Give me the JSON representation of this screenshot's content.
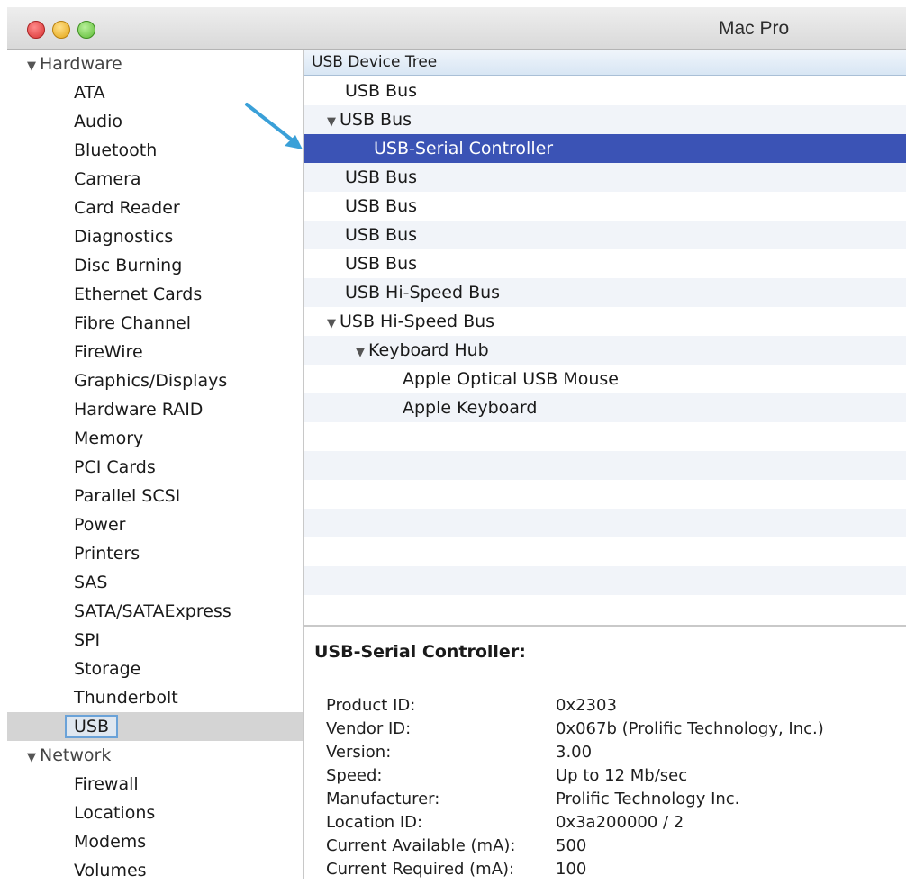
{
  "window": {
    "title": "Mac Pro"
  },
  "sidebar": {
    "hardware": {
      "label": "Hardware",
      "items": [
        "ATA",
        "Audio",
        "Bluetooth",
        "Camera",
        "Card Reader",
        "Diagnostics",
        "Disc Burning",
        "Ethernet Cards",
        "Fibre Channel",
        "FireWire",
        "Graphics/Displays",
        "Hardware RAID",
        "Memory",
        "PCI Cards",
        "Parallel SCSI",
        "Power",
        "Printers",
        "SAS",
        "SATA/SATAExpress",
        "SPI",
        "Storage",
        "Thunderbolt",
        "USB"
      ]
    },
    "network": {
      "label": "Network",
      "items": [
        "Firewall",
        "Locations",
        "Modems",
        "Volumes"
      ]
    },
    "selected": "USB"
  },
  "tree": {
    "header": "USB Device Tree",
    "rows": [
      {
        "label": "USB Bus"
      },
      {
        "label": "USB Bus",
        "expanded": true
      },
      {
        "label": "USB-Serial Controller",
        "selected": true
      },
      {
        "label": "USB Bus"
      },
      {
        "label": "USB Bus"
      },
      {
        "label": "USB Bus"
      },
      {
        "label": "USB Bus"
      },
      {
        "label": "USB Hi-Speed Bus"
      },
      {
        "label": "USB Hi-Speed Bus",
        "expanded": true
      },
      {
        "label": "Keyboard Hub",
        "expanded": true
      },
      {
        "label": "Apple Optical USB Mouse"
      },
      {
        "label": "Apple Keyboard"
      }
    ]
  },
  "detail": {
    "title": "USB-Serial Controller:",
    "fields": [
      {
        "key": "Product ID:",
        "value": "0x2303"
      },
      {
        "key": "Vendor ID:",
        "value": "0x067b  (Prolific Technology, Inc.)"
      },
      {
        "key": "Version:",
        "value": " 3.00"
      },
      {
        "key": "Speed:",
        "value": "Up to 12 Mb/sec"
      },
      {
        "key": "Manufacturer:",
        "value": "Prolific Technology Inc."
      },
      {
        "key": "Location ID:",
        "value": "0x3a200000 / 2"
      },
      {
        "key": "Current Available (mA):",
        "value": "500"
      },
      {
        "key": "Current Required (mA):",
        "value": "100"
      }
    ]
  },
  "colors": {
    "selection": "#3b53b5",
    "arrow": "#3aa0d8",
    "header": "#d8e6f4"
  },
  "icons": {
    "disclosure": "disclosure-triangle-icon",
    "annotation": "arrow-icon"
  }
}
